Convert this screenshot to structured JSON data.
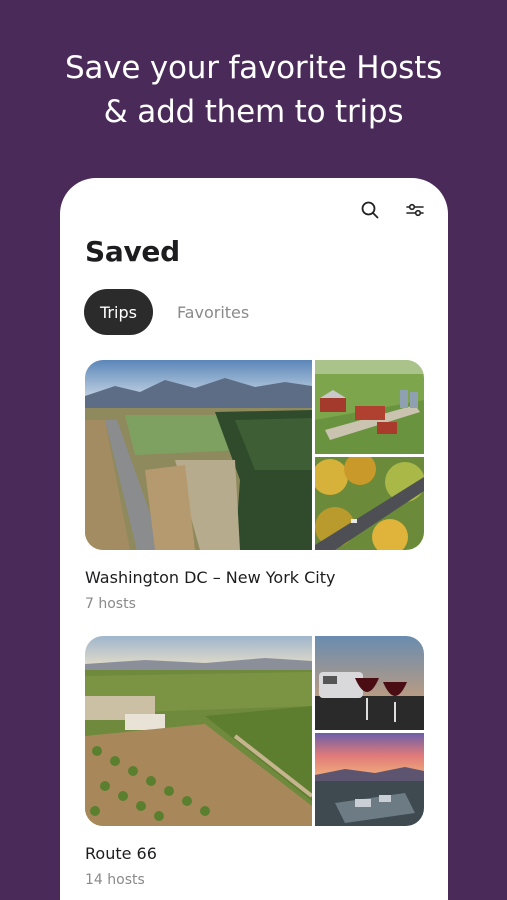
{
  "headline": {
    "line1": "Save your favorite Hosts",
    "line2": "& add them to trips"
  },
  "toolbar": {
    "search_icon": "search-icon",
    "filter_icon": "filter-sliders-icon"
  },
  "page": {
    "title": "Saved"
  },
  "tabs": [
    {
      "label": "Trips",
      "active": true
    },
    {
      "label": "Favorites",
      "active": false
    }
  ],
  "trips": [
    {
      "name": "Washington DC – New York City",
      "hosts": "7 hosts",
      "images": [
        "mountain-valley-road-photo",
        "farm-barns-photo",
        "autumn-forest-road-photo"
      ]
    },
    {
      "name": "Route 66",
      "hosts": "14 hosts",
      "images": [
        "vineyard-orchard-photo",
        "rv-wine-glasses-photo",
        "sunset-campground-photo"
      ]
    }
  ],
  "colors": {
    "background": "#4a2a59",
    "active_tab": "#2b2b2b",
    "muted_text": "#8a8a8a"
  }
}
